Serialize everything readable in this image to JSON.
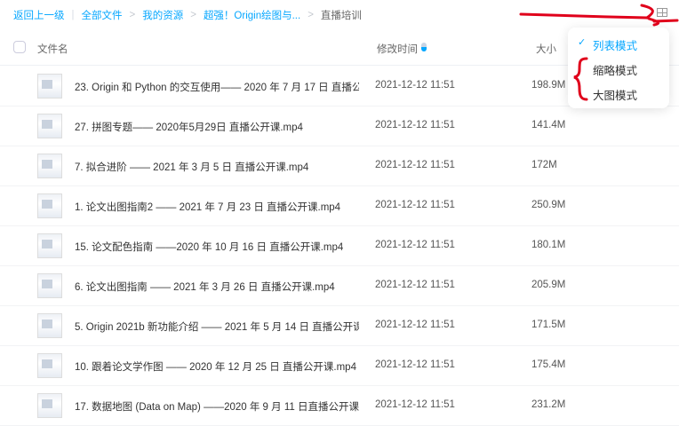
{
  "breadcrumb": {
    "back": "返回上一级",
    "items": [
      "全部文件",
      "我的资源",
      "超强！Origin绘图与..."
    ],
    "current": "直播培训"
  },
  "header": {
    "name": "文件名",
    "modified": "修改时间",
    "size": "大小"
  },
  "view_menu": {
    "items": [
      "列表模式",
      "缩略模式",
      "大图模式"
    ],
    "selected": "列表模式"
  },
  "files": [
    {
      "name": "23. Origin 和 Python 的交互使用—— 2020 年 7 月 17 日 直播公...",
      "date": "2021-12-12 11:51",
      "size": "198.9M"
    },
    {
      "name": "27. 拼图专题—— 2020年5月29日 直播公开课.mp4",
      "date": "2021-12-12 11:51",
      "size": "141.4M"
    },
    {
      "name": "7. 拟合进阶 —— 2021 年 3 月 5 日 直播公开课.mp4",
      "date": "2021-12-12 11:51",
      "size": "172M"
    },
    {
      "name": "1. 论文出图指南2 —— 2021 年 7 月 23 日 直播公开课.mp4",
      "date": "2021-12-12 11:51",
      "size": "250.9M"
    },
    {
      "name": "15. 论文配色指南 ——2020 年 10 月 16 日 直播公开课.mp4",
      "date": "2021-12-12 11:51",
      "size": "180.1M"
    },
    {
      "name": "6. 论文出图指南 —— 2021 年 3 月 26 日 直播公开课.mp4",
      "date": "2021-12-12 11:51",
      "size": "205.9M"
    },
    {
      "name": "5. Origin 2021b 新功能介绍 —— 2021 年 5 月 14 日 直播公开课....",
      "date": "2021-12-12 11:51",
      "size": "171.5M"
    },
    {
      "name": "10. 跟着论文学作图 —— 2020 年 12 月 25 日 直播公开课.mp4",
      "date": "2021-12-12 11:51",
      "size": "175.4M"
    },
    {
      "name": "17. 数据地图 (Data on Map) ——2020 年 9 月 11 日直播公开课....",
      "date": "2021-12-12 11:51",
      "size": "231.2M"
    }
  ],
  "colors": {
    "accent": "#06a7ff",
    "annotation": "#e0001b"
  }
}
